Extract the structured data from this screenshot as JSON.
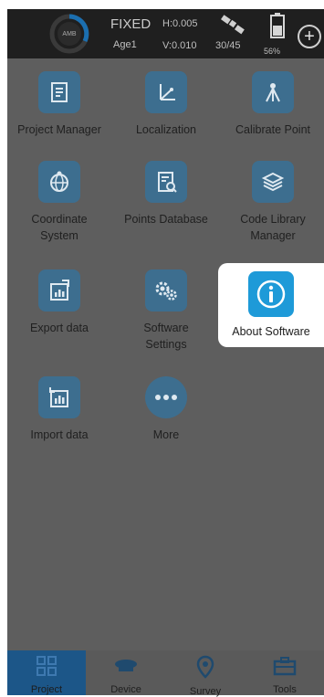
{
  "status": {
    "ring_label": "AMB",
    "fix": "FIXED",
    "age": "Age1",
    "h_precision": "H:0.005",
    "v_precision": "V:0.010",
    "satellites": "30/45",
    "battery": "56%",
    "icons": {
      "satellite": "satellite-icon",
      "battery": "battery-icon",
      "plus": "plus-icon"
    }
  },
  "menu": {
    "project_manager": "Project Manager",
    "localization": "Localization",
    "calibrate_point": "Calibrate Point",
    "coordinate_system_1": "Coordinate",
    "coordinate_system_2": "System",
    "points_database": "Points Database",
    "code_library_1": "Code Library",
    "code_library_2": "Manager",
    "export_data": "Export data",
    "software_settings_1": "Software",
    "software_settings_2": "Settings",
    "about_software": "About Software",
    "import_data": "Import data",
    "more": "More"
  },
  "tabs": {
    "project": "Project",
    "device": "Device",
    "survey": "Survey",
    "tools": "Tools",
    "active": "project"
  },
  "colors": {
    "icon_tile": "#3d6e8f",
    "highlight_icon": "#1e9ad8",
    "overlay": "#5e5e5e",
    "active_tab": "#1c5688"
  }
}
